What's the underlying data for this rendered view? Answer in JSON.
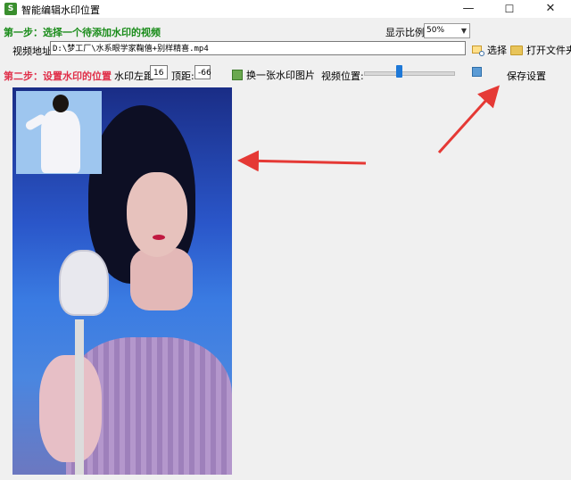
{
  "window": {
    "title": "智能编辑水印位置",
    "app_icon": "app-icon"
  },
  "step1": {
    "title": "第一步：选择一个待添加水印的视频",
    "ratio_label": "显示比例:",
    "ratio_value": "50%",
    "addr_label": "视频地址:",
    "addr_value": "D:\\梦工厂\\水系眼学家鞠僖+别样精喜.mp4",
    "choose_label": "选择",
    "open_folder_label": "打开文件夹"
  },
  "step2": {
    "title": "第二步：设置水印的位置",
    "left_label": "水印左距:",
    "left_value": "16",
    "top_label": "顶距:",
    "top_value": "-66",
    "swap_label": "换一张水印图片",
    "video_pos_label": "视频位置:",
    "video_pos_value": 0.39,
    "save_label": "保存设置"
  },
  "colors": {
    "step1": "#1a8c1a",
    "step2": "#e0304a",
    "slider": "#1e78d7",
    "annotation_arrow": "#e53935"
  }
}
